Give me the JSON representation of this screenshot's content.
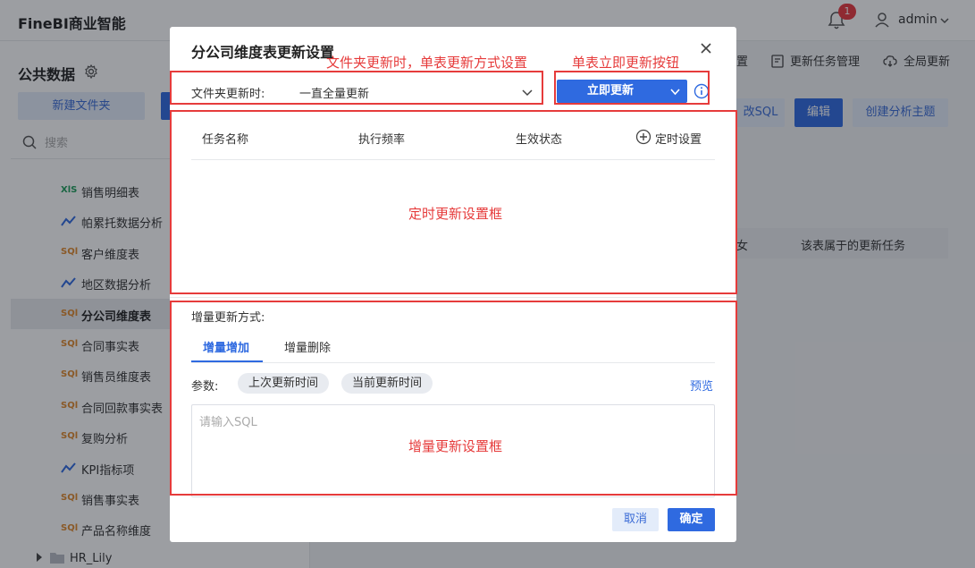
{
  "topbar": {
    "brand": "FineBI商业智能",
    "notification_count": "1",
    "user": "admin"
  },
  "left_panel": {
    "title": "公共数据",
    "new_folder_button": "新建文件夹",
    "search_placeholder": "搜索",
    "items": [
      {
        "type": "xls",
        "icon_text": "XlS",
        "label": "销售明细表"
      },
      {
        "type": "line",
        "icon_text": "",
        "label": "帕累托数据分析"
      },
      {
        "type": "sql",
        "icon_text": "SQl",
        "label": "客户维度表"
      },
      {
        "type": "line",
        "icon_text": "",
        "label": "地区数据分析"
      },
      {
        "type": "sql",
        "icon_text": "SQl",
        "label": "分公司维度表",
        "active": true
      },
      {
        "type": "sql",
        "icon_text": "SQl",
        "label": "合同事实表"
      },
      {
        "type": "sql",
        "icon_text": "SQl",
        "label": "销售员维度表"
      },
      {
        "type": "sql",
        "icon_text": "SQl",
        "label": "合同回款事实表"
      },
      {
        "type": "sql",
        "icon_text": "SQl",
        "label": "复购分析"
      },
      {
        "type": "line",
        "icon_text": "",
        "label": "KPI指标项"
      },
      {
        "type": "sql",
        "icon_text": "SQl",
        "label": "销售事实表"
      },
      {
        "type": "sql",
        "icon_text": "SQl",
        "label": "产品名称维度"
      }
    ],
    "folder": "HR_Lily"
  },
  "background": {
    "toolbar": {
      "settings_tail": "置",
      "update_task_mgmt": "更新任务管理",
      "global_update": "全局更新"
    },
    "buttons": {
      "sql_tail": "改SQL",
      "edit": "编辑",
      "create_topic": "创建分析主题"
    },
    "table": {
      "col_a_tail": "女",
      "col_b": "该表属于的更新任务"
    }
  },
  "dialog": {
    "title": "分公司维度表更新设置",
    "folder_update_label": "文件夹更新时:",
    "folder_update_value": "一直全量更新",
    "update_now_button": "立即更新",
    "table_headers": {
      "task_name": "任务名称",
      "frequency": "执行频率",
      "status": "生效状态",
      "schedule": "定时设置"
    },
    "incremental_label": "增量更新方式:",
    "tabs": {
      "add": "增量增加",
      "delete": "增量删除"
    },
    "params_label": "参数:",
    "chips": {
      "last_update": "上次更新时间",
      "current_update": "当前更新时间"
    },
    "preview": "预览",
    "sql_placeholder": "请输入SQL",
    "cancel": "取消",
    "confirm": "确定"
  },
  "annotations": {
    "folder_setting": "文件夹更新时，单表更新方式设置",
    "update_now": "单表立即更新按钮",
    "schedule_box": "定时更新设置框",
    "incremental_box": "增量更新设置框",
    "color": "#e63b3b"
  }
}
